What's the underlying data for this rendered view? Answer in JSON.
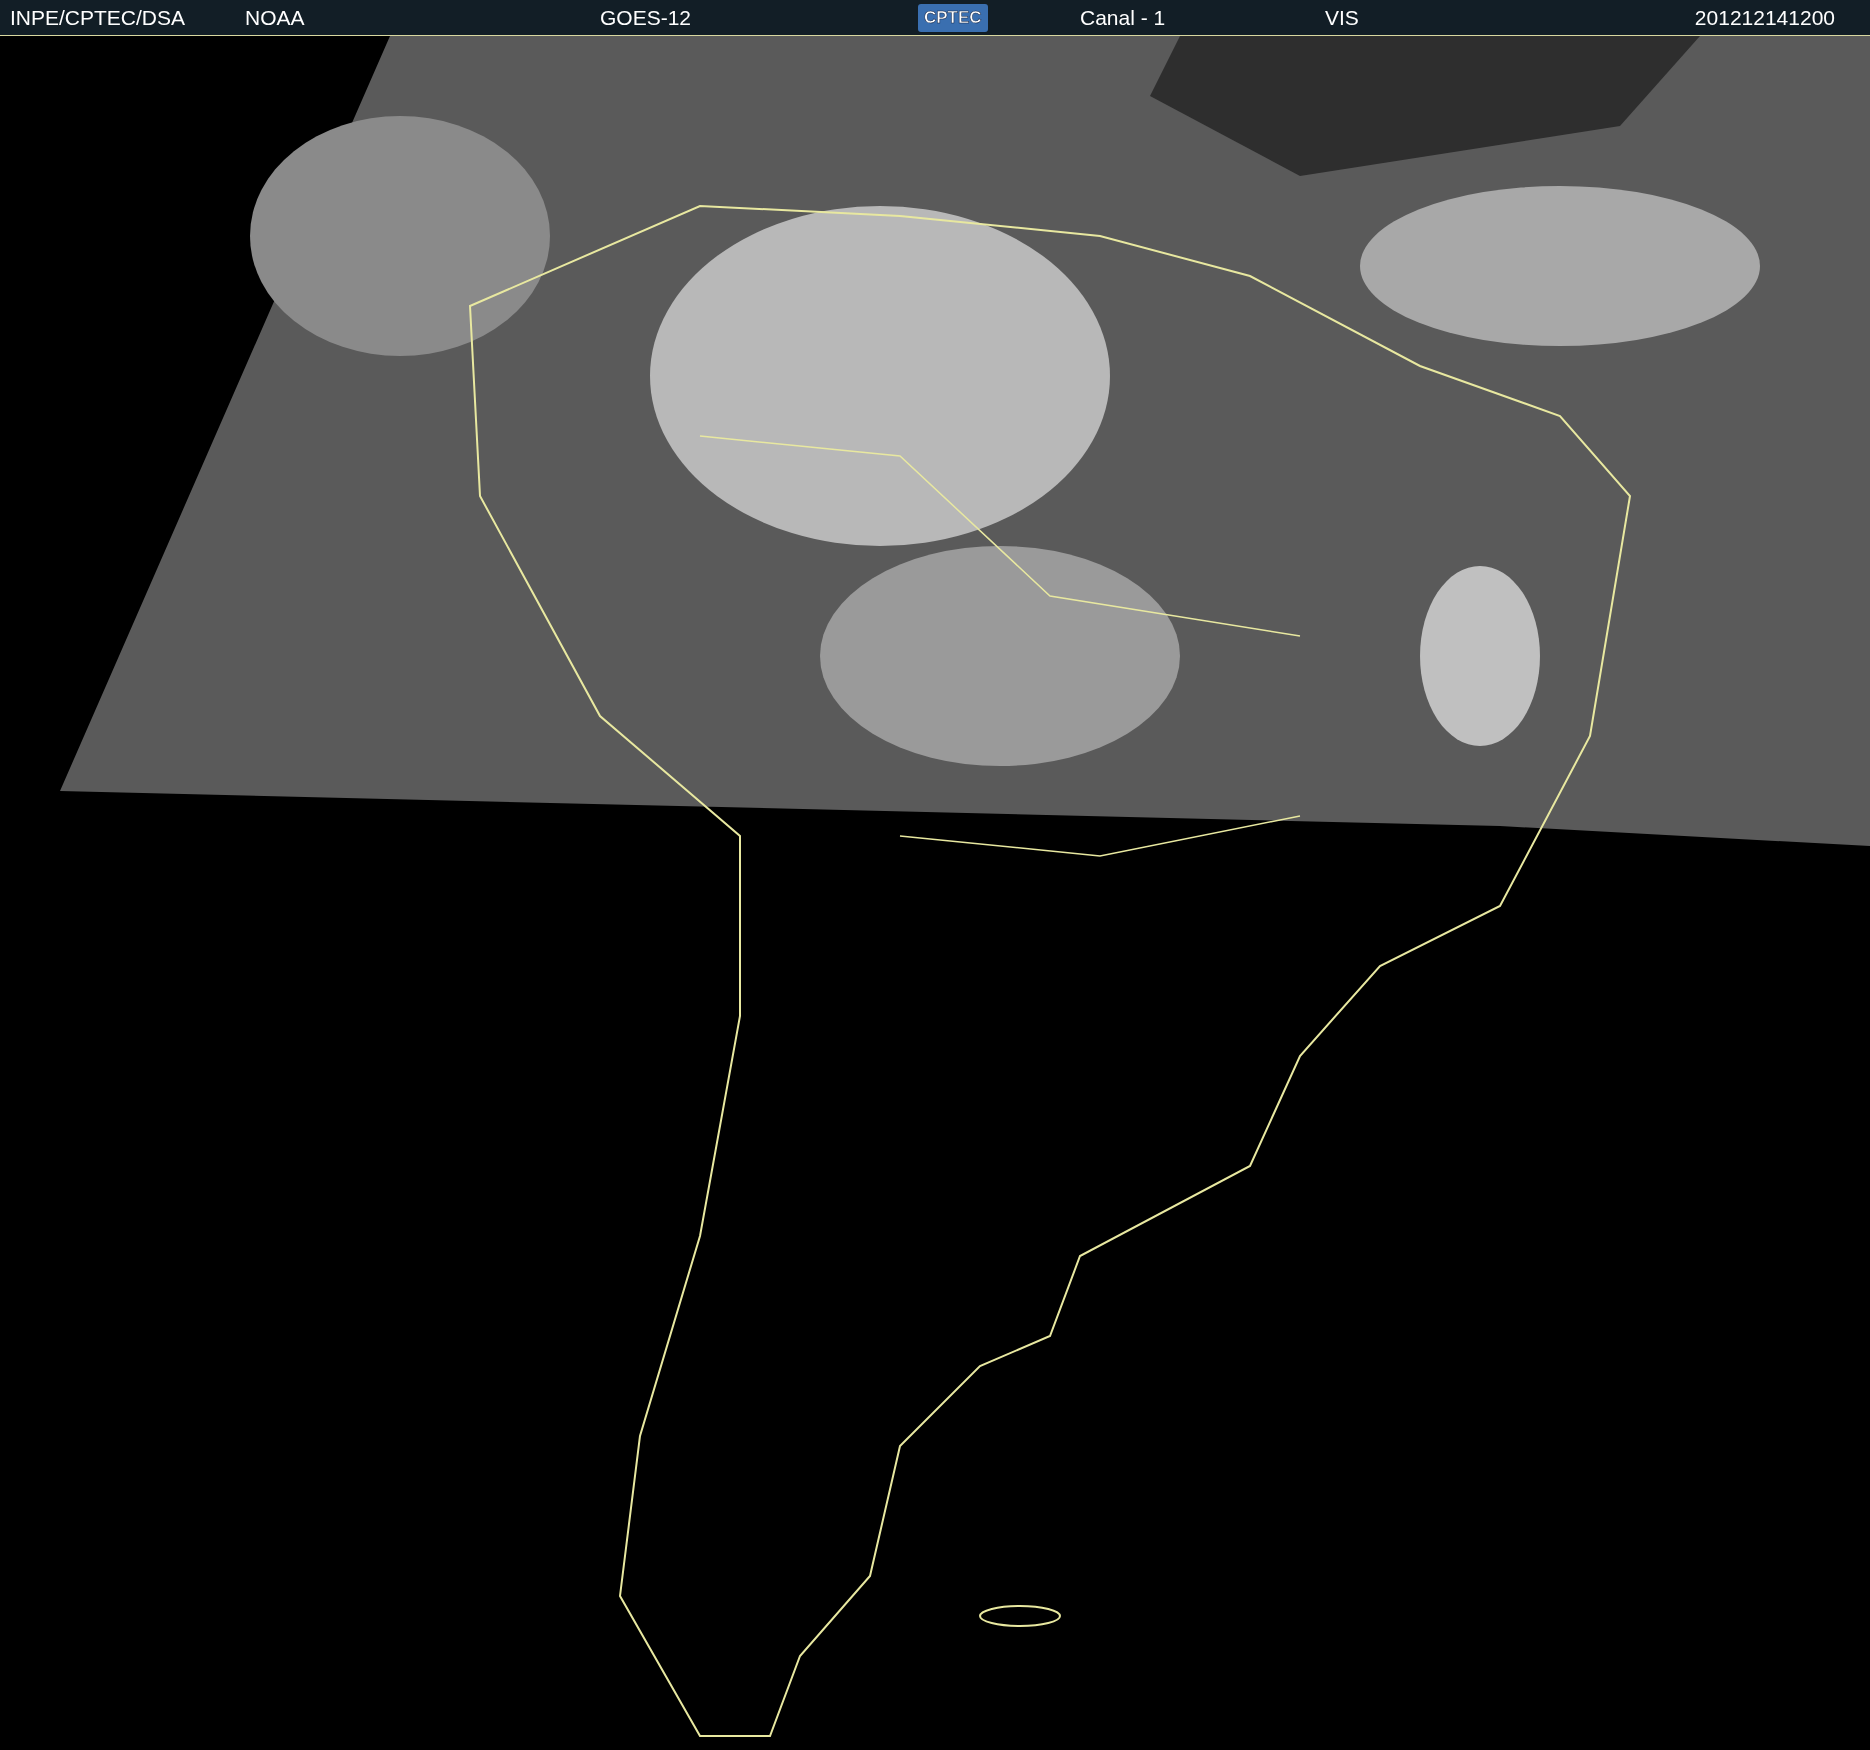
{
  "header": {
    "items": [
      {
        "kind": "text",
        "text": "INPE/CPTEC/DSA"
      },
      {
        "kind": "text",
        "text": "NOAA"
      },
      {
        "kind": "text",
        "text": "GOES-12"
      },
      {
        "kind": "logo",
        "text": "CPTEC"
      },
      {
        "kind": "text",
        "text": "Canal - 1"
      },
      {
        "kind": "text",
        "text": "VIS"
      },
      {
        "kind": "text",
        "text": "201212141200"
      }
    ]
  }
}
